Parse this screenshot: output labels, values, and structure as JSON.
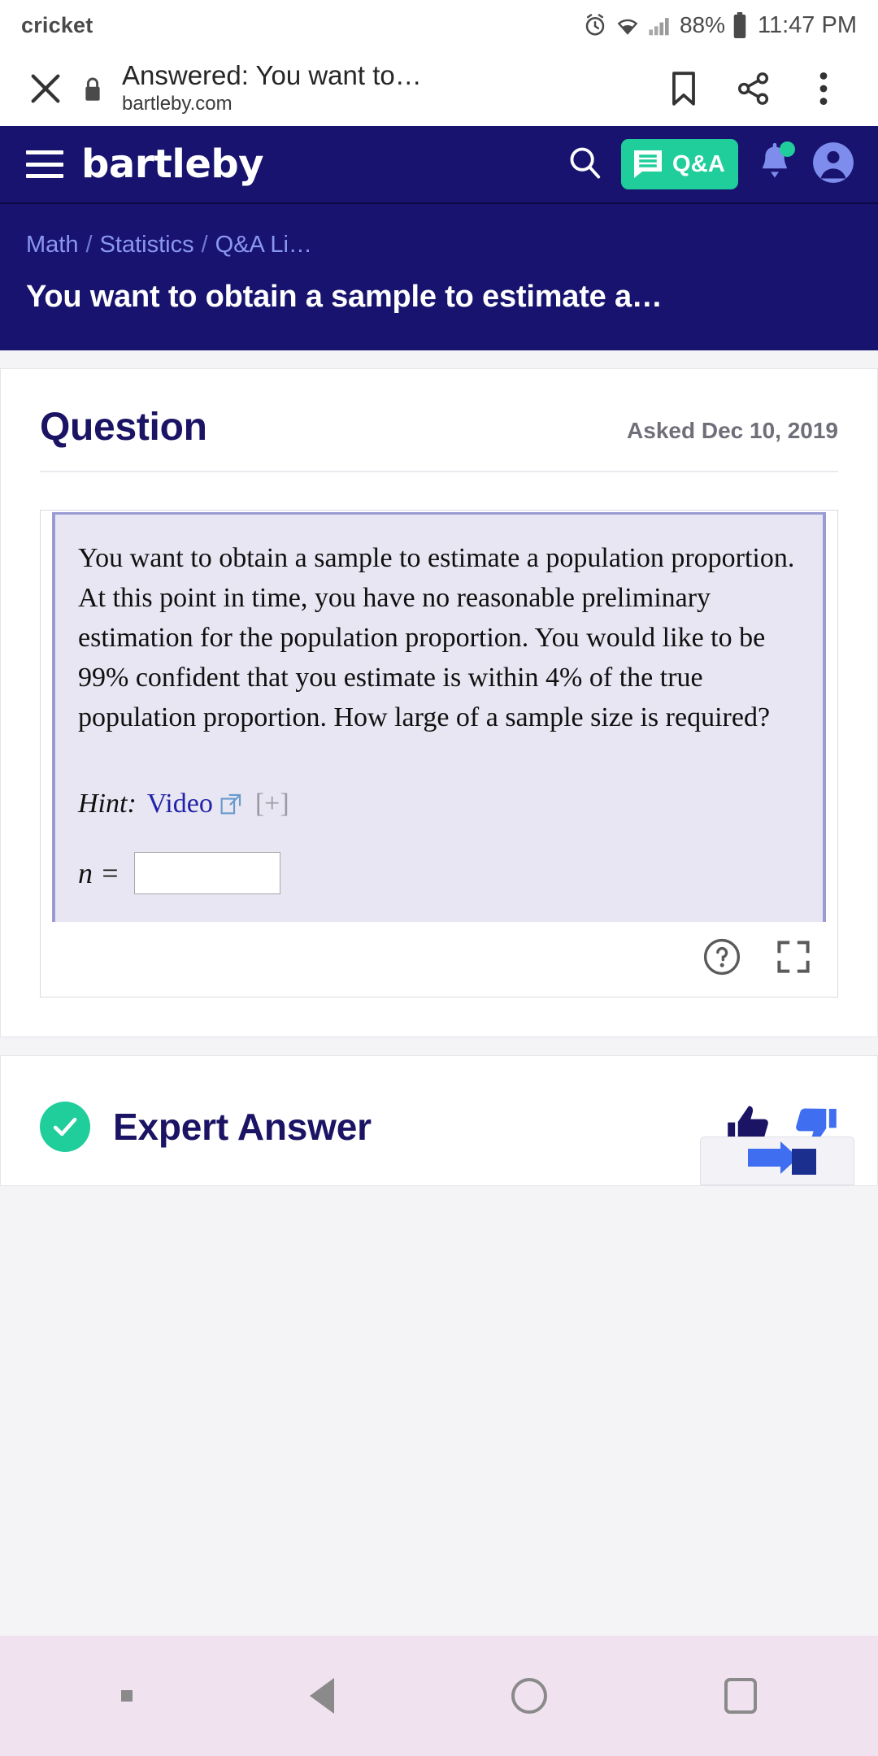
{
  "status_bar": {
    "carrier": "cricket",
    "battery_percent": "88%",
    "clock": "11:47 PM",
    "icons": [
      "alarm-icon",
      "wifi-icon",
      "cellular-signal-icon",
      "battery-icon"
    ]
  },
  "browser_bar": {
    "close_label": "✕",
    "lock_icon": "lock-icon",
    "title": "Answered: You want to…",
    "url": "bartleby.com",
    "actions": [
      "bookmark-icon",
      "share-icon",
      "more-vertical-icon"
    ]
  },
  "nav": {
    "menu_icon": "hamburger-icon",
    "brand": "bartleby",
    "search_icon": "search-icon",
    "qa_button_label": "Q&A",
    "qa_button_icon": "chat-lines-icon",
    "bell_icon": "bell-icon",
    "account_icon": "user-avatar-icon",
    "bg_color": "#18136e",
    "accent_color": "#20ce9b"
  },
  "hero": {
    "breadcrumbs": [
      "Math",
      "Statistics",
      "Q&A Li…"
    ],
    "separator": "/",
    "page_title": "You want to obtain a sample to estimate a…"
  },
  "question_card": {
    "heading": "Question",
    "asked": "Asked Dec 10, 2019",
    "body": "You want to obtain a sample to estimate a population proportion. At this point in time, you have no reasonable preliminary estimation for the population proportion. You would like to be 99% confident that you estimate is within 4% of the true population proportion. How large of a sample size is required?",
    "hint_label": "Hint:",
    "hint_link": "Video",
    "hint_external_icon": "external-link-icon",
    "hint_expand": "[+]",
    "answer_var": "n =",
    "answer_value": "",
    "answer_placeholder": "",
    "footer_icons": [
      "help-circle-icon",
      "expand-fullscreen-icon"
    ]
  },
  "answer_card": {
    "status_icon": "check-circle-icon",
    "heading": "Expert Answer",
    "thumbs_up_icon": "thumb-up-icon",
    "thumbs_down_icon": "thumb-down-icon"
  },
  "android_nav": {
    "items": [
      "keyboard-dot-icon",
      "back-triangle-icon",
      "home-circle-icon",
      "recents-square-icon"
    ]
  }
}
